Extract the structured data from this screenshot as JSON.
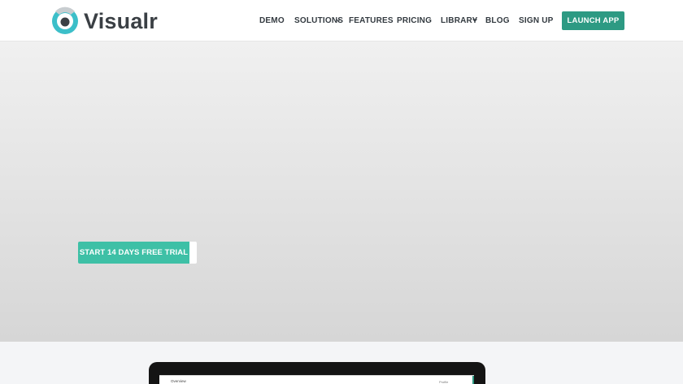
{
  "brand": {
    "name": "Visualr",
    "logo_icon": "eye-logo-icon",
    "accent": "#2d9a83",
    "button_teal": "#3ec0a6"
  },
  "nav": {
    "items": [
      {
        "label": "DEMO"
      },
      {
        "label": "SOLUTIONS",
        "dropdown": true
      },
      {
        "label": "FEATURES"
      },
      {
        "label": "PRICING"
      },
      {
        "label": "LIBRARY",
        "dropdown": true
      },
      {
        "label": "BLOG"
      },
      {
        "label": "SIGN UP"
      }
    ],
    "launch_label": "LAUNCH APP"
  },
  "hero": {
    "cta_label": "START 14 DAYS FREE TRIAL"
  },
  "preview": {
    "title": "Overview",
    "meta": "Profile"
  }
}
